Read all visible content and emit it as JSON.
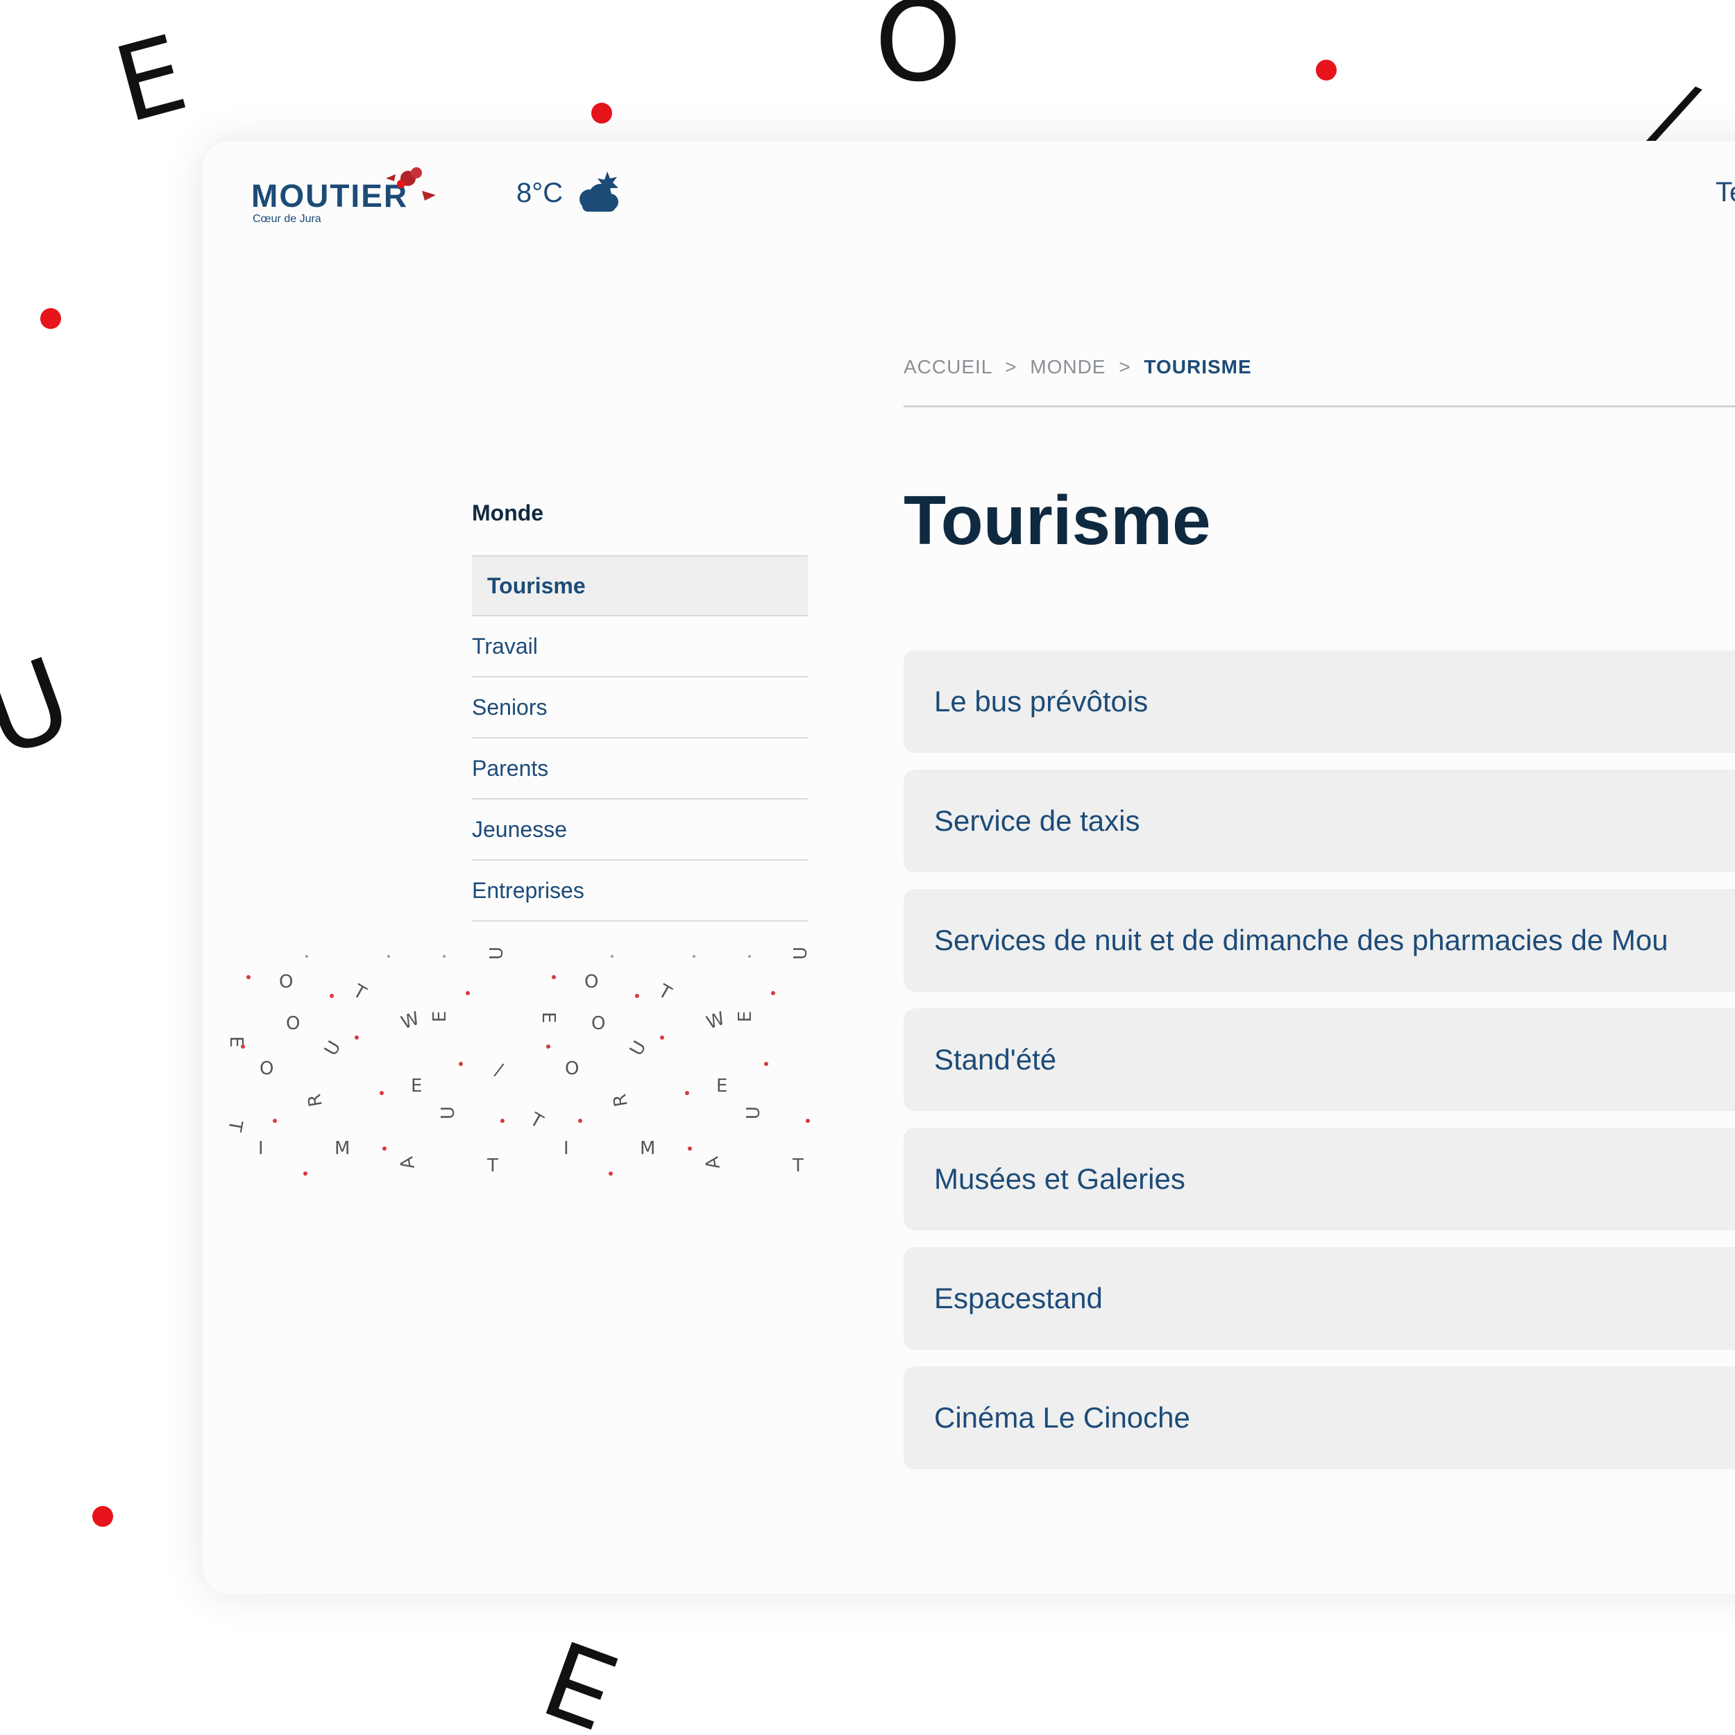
{
  "header": {
    "logo_word": "MOUTIER",
    "logo_sub": "Cœur de Jura",
    "temperature": "8°C",
    "weather_icon": "cloud-sun-icon",
    "cut_text": "Te"
  },
  "breadcrumb": {
    "items": [
      "ACCUEIL",
      "MONDE"
    ],
    "separator": ">",
    "current": "TOURISME"
  },
  "sidebar": {
    "title": "Monde",
    "items": [
      {
        "label": "Tourisme",
        "active": true
      },
      {
        "label": "Travail",
        "active": false
      },
      {
        "label": "Seniors",
        "active": false
      },
      {
        "label": "Parents",
        "active": false
      },
      {
        "label": "Jeunesse",
        "active": false
      },
      {
        "label": "Entreprises",
        "active": false
      }
    ]
  },
  "main": {
    "title": "Tourisme",
    "items": [
      "Le bus prévôtois",
      "Service de taxis",
      "Services de nuit et de dimanche des pharmacies de Mou",
      "Stand'été",
      "Musées et Galeries",
      "Espacestand",
      "Cinéma Le Cinoche"
    ]
  },
  "colors": {
    "brand_blue": "#1c4b78",
    "dark_navy": "#0f2a40",
    "accent_red": "#e8141b",
    "card_bg": "#fcfcfc",
    "item_bg": "#efefef"
  }
}
